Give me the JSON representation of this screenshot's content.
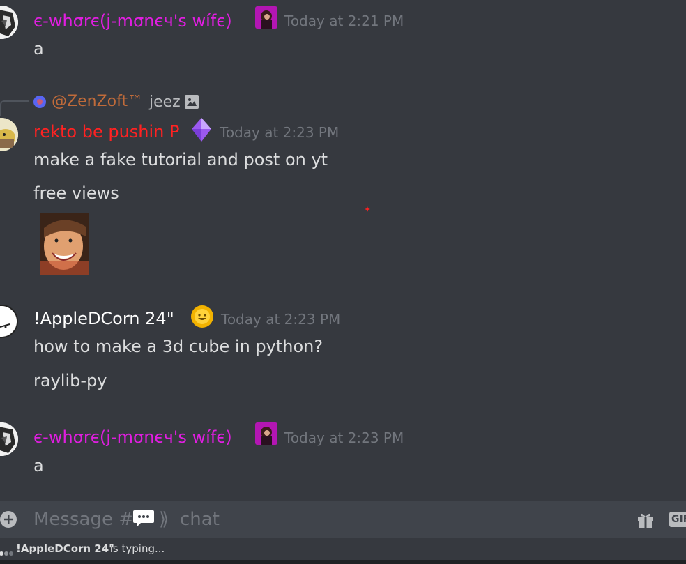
{
  "messages": [
    {
      "username": "є-whσrє(j-mσnєч's wífє)",
      "username_color": "#e01ee0",
      "timestamp": "Today at 2:21 PM",
      "lines": [
        "a"
      ]
    },
    {
      "reply": {
        "mention": "@ZenZoft™",
        "mention_color": "#c06b3a",
        "text": "jeez"
      },
      "username": "rekto be pushin P",
      "username_color": "#ff2222",
      "timestamp": "Today at 2:23 PM",
      "lines": [
        "make a fake tutorial and post on yt",
        "free views"
      ]
    },
    {
      "username": "!AppleDCorn 24\"",
      "username_color": "#ffffff",
      "timestamp": "Today at 2:23 PM",
      "lines": [
        "how to make a 3d cube in python?",
        "raylib-py"
      ]
    },
    {
      "username": "є-whσrє(j-mσnєч's wífє)",
      "username_color": "#e01ee0",
      "timestamp": "Today at 2:23 PM",
      "lines": [
        "a"
      ]
    }
  ],
  "composer": {
    "placeholder_prefix": "Message #",
    "placeholder_suffix": "chat",
    "add_icon": "plus-circle-icon",
    "gift_icon": "gift-icon",
    "gif_label": "GIF"
  },
  "typing": {
    "user": "!AppleDCorn 24\"",
    "suffix": " is typing..."
  },
  "colors": {
    "background": "#36393f",
    "composer": "#40444b",
    "timestamp": "#72767d",
    "text": "#dcddde"
  }
}
